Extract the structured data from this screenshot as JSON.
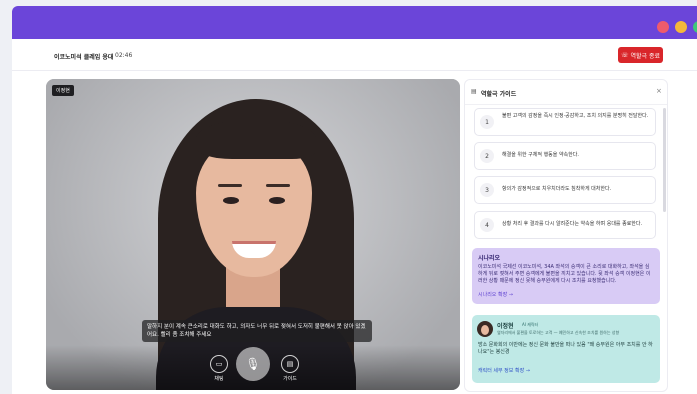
{
  "window": {
    "colors": {
      "titlebar": "#6b45d9",
      "close": "#ef5b6b",
      "minimize": "#f5b83a",
      "maximize": "#3fc77a"
    }
  },
  "header": {
    "title": "이코노미석 클레임 응대",
    "timer": "02:46",
    "end_button": "역할극 종료"
  },
  "video": {
    "speaker_tag": "이정현",
    "subtitle": "말하지 분이 계속 큰소리로 대화도 하고, 의자도 너무 뒤로 젖혀서 도저히 불편해서 못 앉아 있겠어요. 빨리 좀 조치해 주세요",
    "controls": {
      "chat": "채팅",
      "guide": "가이드",
      "mic_icon": "microphone-icon"
    }
  },
  "panel": {
    "title": "역할극 가이드",
    "steps": [
      {
        "num": "1",
        "text": "불편 고객의 감정을 즉시 인정·공감하고, 조치 의지를 분명히 전달한다."
      },
      {
        "num": "2",
        "text": "해결을 위한 구체적 행동을 약속한다."
      },
      {
        "num": "3",
        "text": "항의가 감정적으로 치우치더라도 침착하게 대처한다."
      },
      {
        "num": "4",
        "text": "상황 처리 후 결과를 다시 알려준다는 약속을 하며 응대를 종료한다."
      }
    ],
    "scenario": {
      "title": "시나리오",
      "body": "이코노미석 국제선 이코노미석, 34A 좌석의 승객이 큰 소리로 대화하고, 좌석을 심하게 뒤로 젖혀서 주변 승객에게 불편을 끼치고 있습니다. 뒷 좌석 승객 이정현은 이러한 상황 때문에 정신 못해 승무원에게 다시 조치를 요청했습니다.",
      "link": "시나리오 확장 →"
    },
    "persona": {
      "name": "이정현",
      "tag": "AI 캐릭터",
      "desc": "옆자리에서 불편을 토로하는 고객 — 예민하고 신속한 조치를 원하는 성향",
      "quote": "방소 문화회의 이반에는 정신 문화 불만을 떠나 있음 \"왜 승무원은 아무 조치를 안 하나요\"는 봉신경",
      "link": "캐릭터 세부 정보 확장 →"
    }
  }
}
